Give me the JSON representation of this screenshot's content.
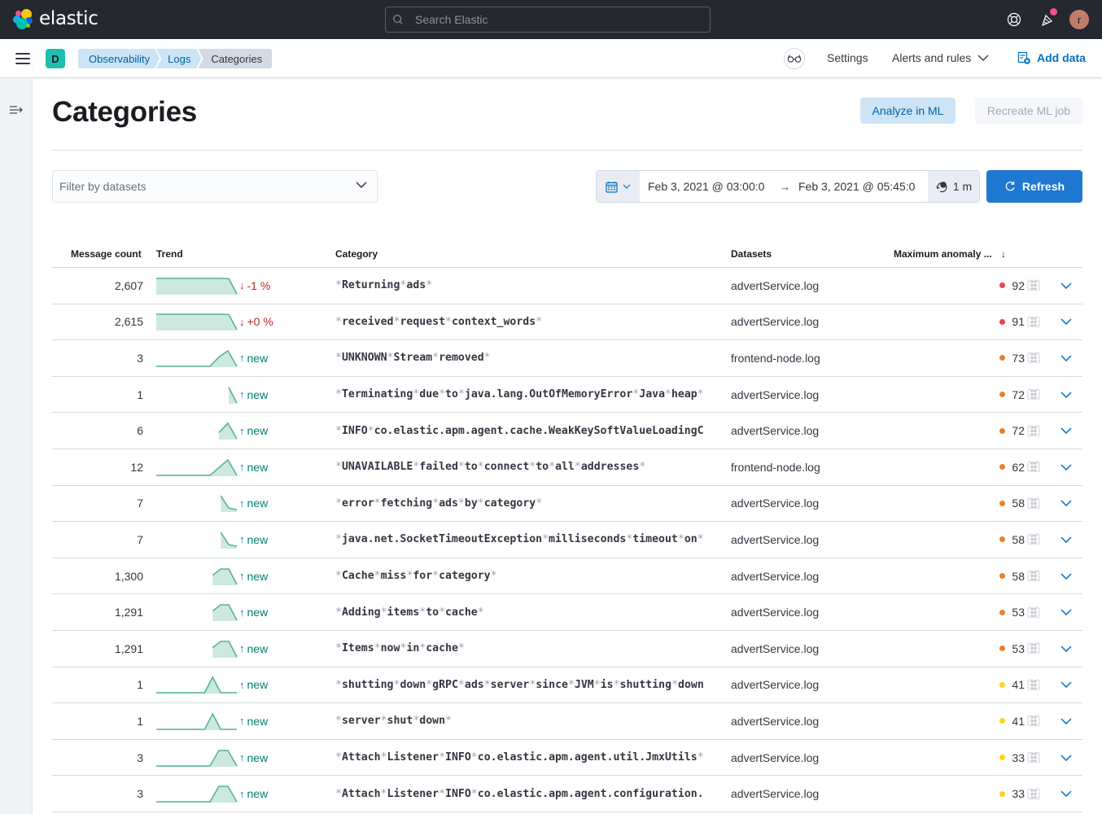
{
  "header": {
    "brand": "elastic",
    "search_placeholder": "Search Elastic",
    "user_initial": "r"
  },
  "subheader": {
    "space_initial": "D",
    "breadcrumbs": [
      "Observability",
      "Logs",
      "Categories"
    ],
    "settings_label": "Settings",
    "alerts_label": "Alerts and rules",
    "add_data_label": "Add data"
  },
  "page": {
    "title": "Categories",
    "analyze_button": "Analyze in ML",
    "recreate_button": "Recreate ML job",
    "dataset_filter_placeholder": "Filter by datasets",
    "date_start": "Feb 3, 2021 @ 03:00:0",
    "date_end": "Feb 3, 2021 @ 05:45:0",
    "date_arrow": "→",
    "refresh_interval": "1 m",
    "refresh_button": "Refresh"
  },
  "table": {
    "columns": [
      "Message count",
      "Trend",
      "Category",
      "Datasets",
      "Maximum anomaly ..."
    ],
    "sort_indicator": "↓",
    "rows": [
      {
        "count": "2,607",
        "trend": [
          1,
          1,
          1,
          1,
          1,
          1,
          1,
          1,
          1,
          0.98,
          0
        ],
        "change": "-1 %",
        "direction": "down",
        "category": [
          "Returning",
          "ads"
        ],
        "dataset": "advertService.log",
        "score": "92",
        "severity": "critical"
      },
      {
        "count": "2,615",
        "trend": [
          1,
          1,
          1,
          1,
          1,
          1,
          1,
          1,
          1,
          0.98,
          0
        ],
        "change": "+0 %",
        "direction": "down",
        "category": [
          "received",
          "request",
          "context_words"
        ],
        "dataset": "advertService.log",
        "score": "91",
        "severity": "critical"
      },
      {
        "count": "3",
        "trend": [
          0,
          0,
          0,
          0,
          0,
          0,
          0,
          0.6,
          1,
          0
        ],
        "change": "new",
        "direction": "up",
        "category": [
          "UNKNOWN",
          "Stream",
          "removed"
        ],
        "dataset": "frontend-node.log",
        "score": "73",
        "severity": "major"
      },
      {
        "count": "1",
        "trend": [
          null,
          null,
          null,
          null,
          null,
          null,
          null,
          null,
          null,
          1,
          0
        ],
        "change": "new",
        "direction": "up",
        "category": [
          "Terminating",
          "due",
          "to",
          "java.lang.OutOfMemoryError",
          "Java",
          "heap"
        ],
        "dataset": "advertService.log",
        "score": "72",
        "severity": "major"
      },
      {
        "count": "6",
        "trend": [
          null,
          null,
          null,
          null,
          null,
          null,
          null,
          0.4,
          1,
          0
        ],
        "change": "new",
        "direction": "up",
        "category": [
          "INFO",
          "co.elastic.apm.agent.cache.WeakKeySoftValueLoadingC"
        ],
        "dataset": "advertService.log",
        "score": "72",
        "severity": "major",
        "truncated": true
      },
      {
        "count": "12",
        "trend": [
          0,
          0,
          0,
          0,
          0,
          0,
          0,
          0.5,
          1,
          0
        ],
        "change": "new",
        "direction": "up",
        "category": [
          "UNAVAILABLE",
          "failed",
          "to",
          "connect",
          "to",
          "all",
          "addresses"
        ],
        "dataset": "frontend-node.log",
        "score": "62",
        "severity": "major"
      },
      {
        "count": "7",
        "trend": [
          null,
          null,
          null,
          null,
          null,
          null,
          null,
          null,
          1,
          0.2,
          0.1
        ],
        "change": "new",
        "direction": "up",
        "category": [
          "error",
          "fetching",
          "ads",
          "by",
          "category"
        ],
        "dataset": "advertService.log",
        "score": "58",
        "severity": "major"
      },
      {
        "count": "7",
        "trend": [
          null,
          null,
          null,
          null,
          null,
          null,
          null,
          null,
          1,
          0.2,
          0.1
        ],
        "change": "new",
        "direction": "up",
        "category": [
          "java.net.SocketTimeoutException",
          "milliseconds",
          "timeout",
          "on"
        ],
        "dataset": "advertService.log",
        "score": "58",
        "severity": "major"
      },
      {
        "count": "1,300",
        "trend": [
          null,
          null,
          null,
          null,
          null,
          null,
          null,
          0.6,
          1,
          1,
          0
        ],
        "change": "new",
        "direction": "up",
        "category": [
          "Cache",
          "miss",
          "for",
          "category"
        ],
        "dataset": "advertService.log",
        "score": "58",
        "severity": "major"
      },
      {
        "count": "1,291",
        "trend": [
          null,
          null,
          null,
          null,
          null,
          null,
          null,
          0.6,
          1,
          1,
          0
        ],
        "change": "new",
        "direction": "up",
        "category": [
          "Adding",
          "items",
          "to",
          "cache"
        ],
        "dataset": "advertService.log",
        "score": "53",
        "severity": "major"
      },
      {
        "count": "1,291",
        "trend": [
          null,
          null,
          null,
          null,
          null,
          null,
          null,
          0.6,
          1,
          1,
          0
        ],
        "change": "new",
        "direction": "up",
        "category": [
          "Items",
          "now",
          "in",
          "cache"
        ],
        "dataset": "advertService.log",
        "score": "53",
        "severity": "major"
      },
      {
        "count": "1",
        "trend": [
          0,
          0,
          0,
          0,
          0,
          0,
          0,
          1,
          0,
          0,
          0
        ],
        "change": "new",
        "direction": "up",
        "category": [
          "shutting",
          "down",
          "gRPC",
          "ads",
          "server",
          "since",
          "JVM",
          "is",
          "shutting",
          "down"
        ],
        "dataset": "advertService.log",
        "score": "41",
        "severity": "minor",
        "truncated": true
      },
      {
        "count": "1",
        "trend": [
          0,
          0,
          0,
          0,
          0,
          0,
          0,
          1,
          0,
          0,
          0
        ],
        "change": "new",
        "direction": "up",
        "category": [
          "server",
          "shut",
          "down"
        ],
        "dataset": "advertService.log",
        "score": "41",
        "severity": "minor"
      },
      {
        "count": "3",
        "trend": [
          0,
          0,
          0,
          0,
          0,
          0,
          0,
          1,
          1,
          0
        ],
        "change": "new",
        "direction": "up",
        "category": [
          "Attach",
          "Listener",
          "INFO",
          "co.elastic.apm.agent.util.JmxUtils"
        ],
        "dataset": "advertService.log",
        "score": "33",
        "severity": "minor"
      },
      {
        "count": "3",
        "trend": [
          0,
          0,
          0,
          0,
          0,
          0,
          0,
          1,
          1,
          0
        ],
        "change": "new",
        "direction": "up",
        "category": [
          "Attach",
          "Listener",
          "INFO",
          "co.elastic.apm.agent.configuration."
        ],
        "dataset": "advertService.log",
        "score": "33",
        "severity": "minor",
        "truncated": true
      }
    ]
  },
  "colors": {
    "critical": "#e7464b",
    "major": "#e7812d",
    "minor": "#fcd61e",
    "trend_line": "#54b399",
    "trend_fill": "#cde9df",
    "accent": "#0071c2"
  }
}
